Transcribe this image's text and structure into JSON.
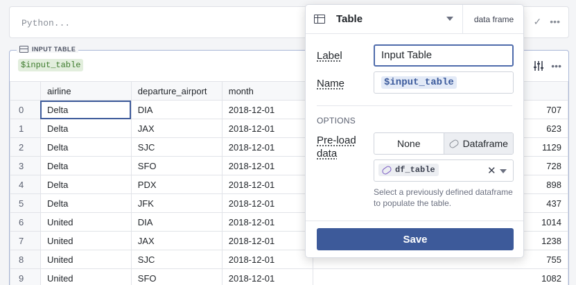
{
  "python_cell": {
    "placeholder": "Python...",
    "check_icon": "✓",
    "more_icon": "•••"
  },
  "table_cell": {
    "tag_label": "INPUT TABLE",
    "variable": "$input_table",
    "columns": [
      "airline",
      "departure_airport",
      "month"
    ],
    "rows": [
      {
        "idx": "0",
        "airline": "Delta",
        "airport": "DIA",
        "month": "2018-12-01",
        "value": "707"
      },
      {
        "idx": "1",
        "airline": "Delta",
        "airport": "JAX",
        "month": "2018-12-01",
        "value": "623"
      },
      {
        "idx": "2",
        "airline": "Delta",
        "airport": "SJC",
        "month": "2018-12-01",
        "value": "1129"
      },
      {
        "idx": "3",
        "airline": "Delta",
        "airport": "SFO",
        "month": "2018-12-01",
        "value": "728"
      },
      {
        "idx": "4",
        "airline": "Delta",
        "airport": "PDX",
        "month": "2018-12-01",
        "value": "898"
      },
      {
        "idx": "5",
        "airline": "Delta",
        "airport": "JFK",
        "month": "2018-12-01",
        "value": "437"
      },
      {
        "idx": "6",
        "airline": "United",
        "airport": "DIA",
        "month": "2018-12-01",
        "value": "1014"
      },
      {
        "idx": "7",
        "airline": "United",
        "airport": "JAX",
        "month": "2018-12-01",
        "value": "1238"
      },
      {
        "idx": "8",
        "airline": "United",
        "airport": "SJC",
        "month": "2018-12-01",
        "value": "755"
      },
      {
        "idx": "9",
        "airline": "United",
        "airport": "SFO",
        "month": "2018-12-01",
        "value": "1082"
      }
    ],
    "more_icon": "•••"
  },
  "popover": {
    "type_label": "Table",
    "tab_label": "data frame",
    "label_label": "Label",
    "label_value": "Input Table",
    "name_label": "Name",
    "name_value": "$input_table",
    "options_heading": "OPTIONS",
    "preload_line1": "Pre-load",
    "preload_line2": "data",
    "seg_none": "None",
    "seg_dataframe": "Dataframe",
    "selected_df": "df_table",
    "clear_icon": "✕",
    "help_text": "Select a previously defined dataframe to populate the table.",
    "save_label": "Save"
  },
  "colors": {
    "accent": "#3d5a9a",
    "var_chip_bg": "#e2eedd",
    "var_chip_text": "#3c7a2c"
  }
}
